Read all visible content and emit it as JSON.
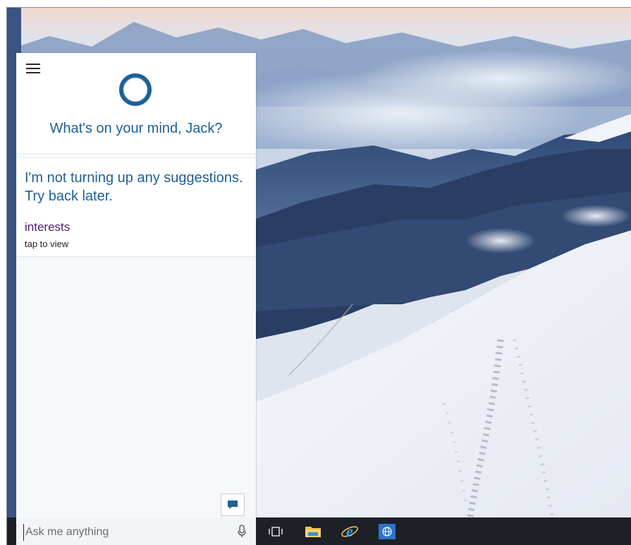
{
  "cortana": {
    "greeting": "What's on your mind, Jack?",
    "suggestion_message": "I'm not turning up any suggestions. Try back later.",
    "interests_label": "interests",
    "tap_label": "tap to view"
  },
  "taskbar": {
    "search_placeholder": "Ask me anything",
    "pinned_icons": [
      "task-view-icon",
      "file-explorer-icon",
      "internet-explorer-icon",
      "globe-app-icon"
    ]
  },
  "colors": {
    "accent_blue": "#1f5f98",
    "interests_purple": "#4a1d6b",
    "taskbar_bg": "#1d2026",
    "panel_bg": "#f7f8fa"
  }
}
